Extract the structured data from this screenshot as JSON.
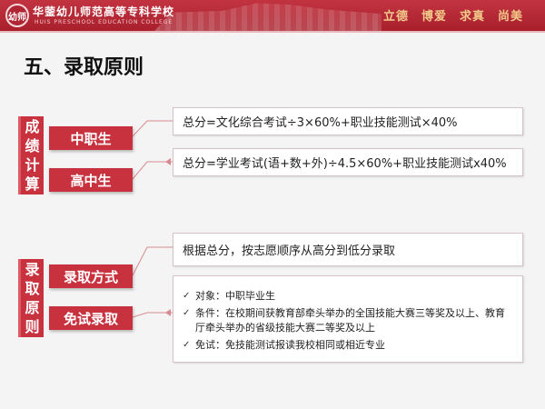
{
  "header": {
    "logo_text": "幼师",
    "school_name": "华蓥幼儿师范高等专科学校",
    "school_name_en": "HUIS PRESCHOOL EDUCATION COLLEGE",
    "mottos": [
      "立德",
      "博爱",
      "求真",
      "尚美"
    ]
  },
  "title": "五、录取原则",
  "section1": {
    "label_chars": [
      "成",
      "绩",
      "计",
      "算"
    ],
    "tag1": "中职生",
    "tag2": "高中生",
    "formula1": "总分=文化综合考试÷3×60%+职业技能测试×40%",
    "formula2": "总分=学业考试(语+数+外)÷4.5×60%+职业技能测试x40%"
  },
  "section2": {
    "label_chars": [
      "录",
      "取",
      "原",
      "则"
    ],
    "tag1": "录取方式",
    "tag2": "免试录取",
    "method_text": "根据总分，按志愿顺序从高分到低分录取",
    "items": [
      "对象：中职毕业生",
      "条件：在校期间获教育部牵头举办的全国技能大赛三等奖及以上、教育厅牵头举办的省级技能大赛二等奖及以上",
      "免试：免技能测试报读我校相同或相近专业"
    ],
    "check_glyph": "✓"
  },
  "colors": {
    "brand_red": "#c8323f",
    "header_red": "#b02533",
    "motto_gold": "#f2c98a"
  }
}
